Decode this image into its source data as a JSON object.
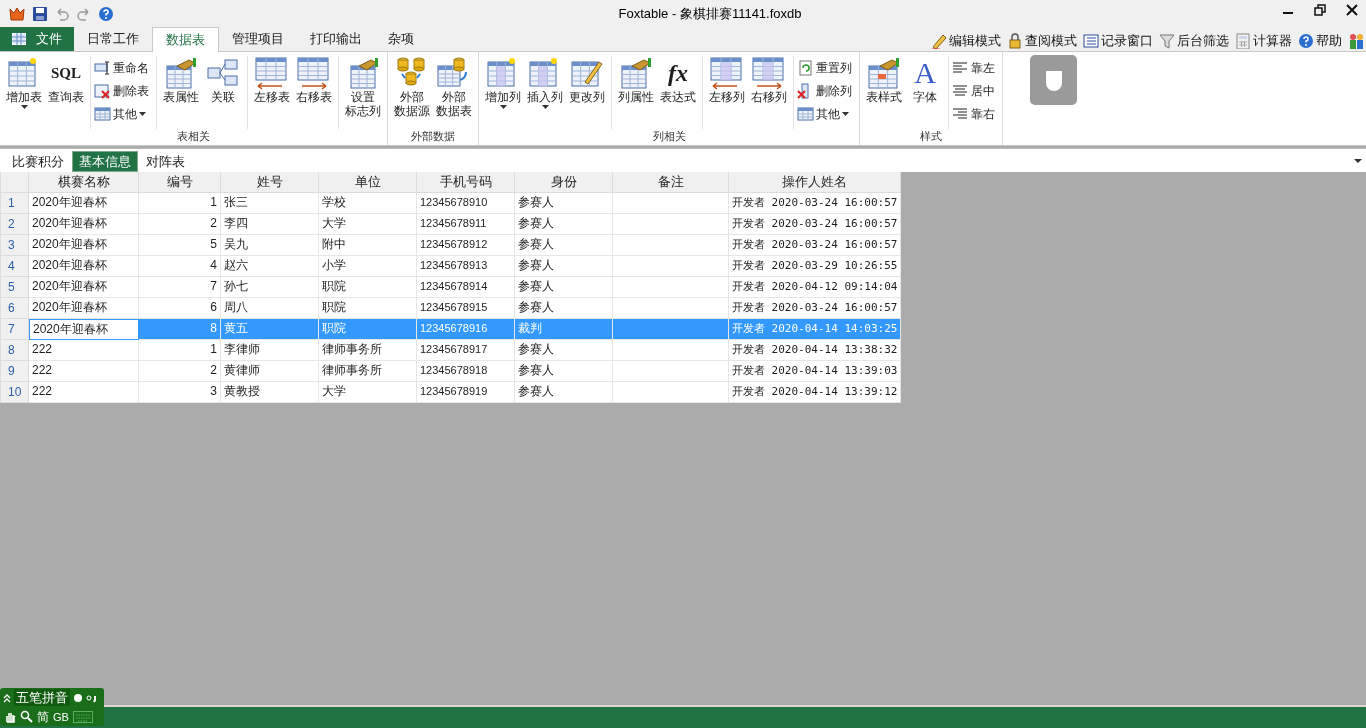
{
  "window": {
    "title": "Foxtable - 象棋排赛11141.foxdb"
  },
  "ribbon_tabs": [
    {
      "label": "文件",
      "kind": "file",
      "selected": false
    },
    {
      "label": "日常工作",
      "kind": "tab",
      "selected": false
    },
    {
      "label": "数据表",
      "kind": "tab",
      "selected": true
    },
    {
      "label": "管理项目",
      "kind": "tab",
      "selected": false
    },
    {
      "label": "打印输出",
      "kind": "tab",
      "selected": false
    },
    {
      "label": "杂项",
      "kind": "tab",
      "selected": false
    }
  ],
  "quick_actions": [
    "编辑模式",
    "查阅模式",
    "记录窗口",
    "后台筛选",
    "计算器",
    "帮助"
  ],
  "ribbon_groups": [
    {
      "title": "表相关",
      "sections": [
        [
          {
            "kind": "large",
            "label": "增加表",
            "dropdown": true
          },
          {
            "kind": "large",
            "label": "查询表",
            "icon_text": "SQL",
            "dropdown": false
          }
        ],
        [
          {
            "kind": "small",
            "label": "重命名",
            "dropdown": false
          },
          {
            "kind": "small",
            "label": "删除表",
            "dropdown": false
          },
          {
            "kind": "small",
            "label": "其他",
            "dropdown": true
          }
        ],
        [
          {
            "kind": "large",
            "label": "表属性",
            "dropdown": false
          },
          {
            "kind": "large",
            "label": "关联",
            "dropdown": false
          }
        ],
        [
          {
            "kind": "large",
            "label": "左移表",
            "dropdown": false
          },
          {
            "kind": "large",
            "label": "右移表",
            "dropdown": false
          }
        ],
        [
          {
            "kind": "large",
            "lines": [
              "设置",
              "标志列"
            ],
            "dropdown": false
          }
        ]
      ]
    },
    {
      "title": "外部数据",
      "sections": [
        [
          {
            "kind": "large",
            "lines": [
              "外部",
              "数据源"
            ],
            "dropdown": false
          },
          {
            "kind": "large",
            "lines": [
              "外部",
              "数据表"
            ],
            "dropdown": false
          }
        ]
      ]
    },
    {
      "title": "列相关",
      "sections": [
        [
          {
            "kind": "large",
            "label": "增加列",
            "dropdown": true
          },
          {
            "kind": "large",
            "label": "插入列",
            "dropdown": true
          },
          {
            "kind": "large",
            "label": "更改列",
            "dropdown": false
          }
        ],
        [
          {
            "kind": "large",
            "label": "列属性",
            "dropdown": false
          },
          {
            "kind": "large",
            "label": "表达式",
            "icon_text": "fx",
            "dropdown": false
          }
        ],
        [
          {
            "kind": "large",
            "label": "左移列",
            "dropdown": false
          },
          {
            "kind": "large",
            "label": "右移列",
            "dropdown": false
          }
        ],
        [
          {
            "kind": "small",
            "label": "重置列",
            "dropdown": false
          },
          {
            "kind": "small",
            "label": "删除列",
            "dropdown": false
          },
          {
            "kind": "small",
            "label": "其他",
            "dropdown": true
          }
        ]
      ]
    },
    {
      "title": "样式",
      "sections": [
        [
          {
            "kind": "large",
            "label": "表样式",
            "dropdown": false
          },
          {
            "kind": "large",
            "label": "字体",
            "icon_text": "A",
            "dropdown": false
          }
        ],
        [
          {
            "kind": "small",
            "label": "靠左",
            "dropdown": false
          },
          {
            "kind": "small",
            "label": "居中",
            "dropdown": false
          },
          {
            "kind": "small",
            "label": "靠右",
            "dropdown": false
          }
        ]
      ]
    }
  ],
  "sheet_tabs": [
    {
      "label": "比赛积分",
      "selected": false
    },
    {
      "label": "基本信息",
      "selected": true
    },
    {
      "label": "对阵表",
      "selected": false
    }
  ],
  "table": {
    "columns": [
      "棋赛名称",
      "编号",
      "姓号",
      "单位",
      "手机号码",
      "身份",
      "备注",
      "操作人姓名"
    ],
    "rows": [
      {
        "number": "1",
        "cells": [
          "2020年迎春杯",
          "1",
          "张三",
          "学校",
          "12345678910",
          "参赛人",
          "",
          "开发者 2020-03-24 16:00:57"
        ],
        "selected": false,
        "current": false
      },
      {
        "number": "2",
        "cells": [
          "2020年迎春杯",
          "2",
          "李四",
          "大学",
          "12345678911",
          "参赛人",
          "",
          "开发者 2020-03-24 16:00:57"
        ],
        "selected": false,
        "current": false
      },
      {
        "number": "3",
        "cells": [
          "2020年迎春杯",
          "5",
          "吴九",
          "附中",
          "12345678912",
          "参赛人",
          "",
          "开发者 2020-03-24 16:00:57"
        ],
        "selected": false,
        "current": false
      },
      {
        "number": "4",
        "cells": [
          "2020年迎春杯",
          "4",
          "赵六",
          "小学",
          "12345678913",
          "参赛人",
          "",
          "开发者 2020-03-29 10:26:55"
        ],
        "selected": false,
        "current": false
      },
      {
        "number": "5",
        "cells": [
          "2020年迎春杯",
          "7",
          "孙七",
          "职院",
          "12345678914",
          "参赛人",
          "",
          "开发者 2020-04-12 09:14:04"
        ],
        "selected": false,
        "current": false
      },
      {
        "number": "6",
        "cells": [
          "2020年迎春杯",
          "6",
          "周八",
          "职院",
          "12345678915",
          "参赛人",
          "",
          "开发者 2020-03-24 16:00:57"
        ],
        "selected": false,
        "current": false
      },
      {
        "number": "7",
        "cells": [
          "2020年迎春杯",
          "8",
          "黄五",
          "职院",
          "12345678916",
          "裁判",
          "",
          "开发者 2020-04-14 14:03:25"
        ],
        "selected": true,
        "current": true
      },
      {
        "number": "8",
        "cells": [
          "222",
          "1",
          "李律师",
          "律师事务所",
          "12345678917",
          "参赛人",
          "",
          "开发者 2020-04-14 13:38:32"
        ],
        "selected": false,
        "current": false
      },
      {
        "number": "9",
        "cells": [
          "222",
          "2",
          "黄律师",
          "律师事务所",
          "12345678918",
          "参赛人",
          "",
          "开发者 2020-04-14 13:39:03"
        ],
        "selected": false,
        "current": false
      },
      {
        "number": "10",
        "cells": [
          "222",
          "3",
          "黄教授",
          "大学",
          "12345678919",
          "参赛人",
          "",
          "开发者 2020-04-14 13:39:12"
        ],
        "selected": false,
        "current": false
      }
    ]
  },
  "ime": {
    "mode": "五笔拼音",
    "charset": "简",
    "encoding": "GB"
  }
}
